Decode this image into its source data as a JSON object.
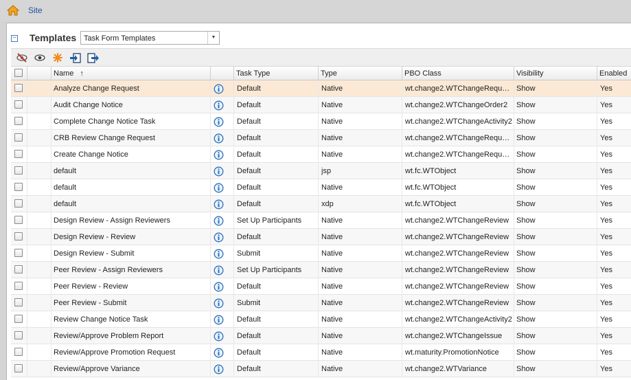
{
  "header": {
    "site_link": "Site",
    "home_icon": "home-icon"
  },
  "panel": {
    "title": "Templates",
    "collapse_symbol": "−",
    "selector": {
      "value": "Task Form Templates"
    }
  },
  "toolbar": {
    "icons": [
      "hide-icon",
      "view-icon",
      "new-icon",
      "import-icon",
      "export-icon"
    ]
  },
  "table": {
    "columns": {
      "name": "Name",
      "sort_indicator": "↑",
      "task_type": "Task Type",
      "type": "Type",
      "pbo_class": "PBO Class",
      "visibility": "Visibility",
      "enabled": "Enabled"
    },
    "selected_row": 0,
    "rows": [
      {
        "name": "Analyze Change Request",
        "task_type": "Default",
        "type": "Native",
        "pbo_class": "wt.change2.WTChangeRequ…",
        "visibility": "Show",
        "enabled": "Yes"
      },
      {
        "name": "Audit Change Notice",
        "task_type": "Default",
        "type": "Native",
        "pbo_class": "wt.change2.WTChangeOrder2",
        "visibility": "Show",
        "enabled": "Yes"
      },
      {
        "name": "Complete Change Notice Task",
        "task_type": "Default",
        "type": "Native",
        "pbo_class": "wt.change2.WTChangeActivity2",
        "visibility": "Show",
        "enabled": "Yes"
      },
      {
        "name": "CRB Review Change Request",
        "task_type": "Default",
        "type": "Native",
        "pbo_class": "wt.change2.WTChangeRequ…",
        "visibility": "Show",
        "enabled": "Yes"
      },
      {
        "name": "Create Change Notice",
        "task_type": "Default",
        "type": "Native",
        "pbo_class": "wt.change2.WTChangeRequ…",
        "visibility": "Show",
        "enabled": "Yes"
      },
      {
        "name": "default",
        "task_type": "Default",
        "type": "jsp",
        "pbo_class": "wt.fc.WTObject",
        "visibility": "Show",
        "enabled": "Yes"
      },
      {
        "name": "default",
        "task_type": "Default",
        "type": "Native",
        "pbo_class": "wt.fc.WTObject",
        "visibility": "Show",
        "enabled": "Yes"
      },
      {
        "name": "default",
        "task_type": "Default",
        "type": "xdp",
        "pbo_class": "wt.fc.WTObject",
        "visibility": "Show",
        "enabled": "Yes"
      },
      {
        "name": "Design Review - Assign Reviewers",
        "task_type": "Set Up Participants",
        "type": "Native",
        "pbo_class": "wt.change2.WTChangeReview",
        "visibility": "Show",
        "enabled": "Yes"
      },
      {
        "name": "Design Review - Review",
        "task_type": "Default",
        "type": "Native",
        "pbo_class": "wt.change2.WTChangeReview",
        "visibility": "Show",
        "enabled": "Yes"
      },
      {
        "name": "Design Review - Submit",
        "task_type": "Submit",
        "type": "Native",
        "pbo_class": "wt.change2.WTChangeReview",
        "visibility": "Show",
        "enabled": "Yes"
      },
      {
        "name": "Peer Review - Assign Reviewers",
        "task_type": "Set Up Participants",
        "type": "Native",
        "pbo_class": "wt.change2.WTChangeReview",
        "visibility": "Show",
        "enabled": "Yes"
      },
      {
        "name": "Peer Review - Review",
        "task_type": "Default",
        "type": "Native",
        "pbo_class": "wt.change2.WTChangeReview",
        "visibility": "Show",
        "enabled": "Yes"
      },
      {
        "name": "Peer Review - Submit",
        "task_type": "Submit",
        "type": "Native",
        "pbo_class": "wt.change2.WTChangeReview",
        "visibility": "Show",
        "enabled": "Yes"
      },
      {
        "name": "Review Change Notice Task",
        "task_type": "Default",
        "type": "Native",
        "pbo_class": "wt.change2.WTChangeActivity2",
        "visibility": "Show",
        "enabled": "Yes"
      },
      {
        "name": "Review/Approve Problem Report",
        "task_type": "Default",
        "type": "Native",
        "pbo_class": "wt.change2.WTChangeIssue",
        "visibility": "Show",
        "enabled": "Yes"
      },
      {
        "name": "Review/Approve Promotion Request",
        "task_type": "Default",
        "type": "Native",
        "pbo_class": "wt.maturity.PromotionNotice",
        "visibility": "Show",
        "enabled": "Yes"
      },
      {
        "name": "Review/Approve Variance",
        "task_type": "Default",
        "type": "Native",
        "pbo_class": "wt.change2.WTVariance",
        "visibility": "Show",
        "enabled": "Yes"
      }
    ]
  },
  "colors": {
    "link": "#1e50a2",
    "info_icon": "#2a6fb8",
    "selected_row": "#fbe9d6"
  }
}
